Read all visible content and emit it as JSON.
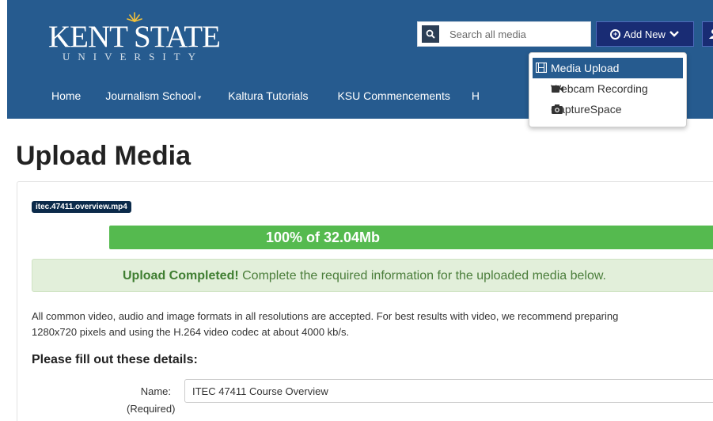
{
  "header": {
    "logo_main": "KENT STATE",
    "logo_sub": "UNIVERSITY",
    "background_color": "#265b8f"
  },
  "search": {
    "placeholder": "Search all media",
    "icon": "search-icon"
  },
  "add_new": {
    "label": "Add New",
    "icon": "plus-circle-icon",
    "chevron": "chevron-down-icon"
  },
  "user_button": {
    "icon": "user-icon"
  },
  "nav": {
    "items": [
      {
        "label": "Home",
        "has_dropdown": false
      },
      {
        "label": "Journalism School",
        "has_dropdown": true
      },
      {
        "label": "Kaltura Tutorials",
        "has_dropdown": false
      },
      {
        "label": "KSU Commencements",
        "has_dropdown": false
      },
      {
        "label": "H",
        "has_dropdown": false
      }
    ]
  },
  "dropdown": {
    "items": [
      {
        "label": "Media Upload",
        "icon": "film-icon",
        "active": true
      },
      {
        "label": "Webcam Recording",
        "icon": "video-camera-icon",
        "active": false
      },
      {
        "label": "CaptureSpace",
        "icon": "camera-icon",
        "active": false
      }
    ]
  },
  "page": {
    "title": "Upload Media",
    "file_name": "itec.47411.overview.mp4",
    "progress_percent": 100,
    "progress_text": "100% of 32.04Mb",
    "alert_strong": "Upload Completed!",
    "alert_text": " Complete the required information for the uploaded media below.",
    "info_line1": "All common video, audio and image formats in all resolutions are accepted. For best results with video, we recommend preparing",
    "info_line2": "1280x720 pixels and using the H.264 video codec at about 4000 kb/s.",
    "details_title": "Please fill out these details:",
    "name_label": "Name:",
    "name_required": "(Required)",
    "name_value": "ITEC 47411 Course Overview"
  },
  "colors": {
    "accent": "#265b8f",
    "button": "#192c74",
    "progress": "#55ba4f",
    "alert_bg": "#e2efda"
  }
}
